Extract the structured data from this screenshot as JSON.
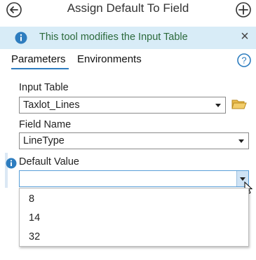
{
  "header": {
    "title": "Assign Default To Field",
    "back_icon": "back-arrow-icon",
    "add_icon": "add-icon"
  },
  "info_bar": {
    "message": "This tool modifies the Input Table",
    "icon": "info-icon",
    "close_glyph": "×"
  },
  "tabs": [
    {
      "label": "Parameters",
      "active": true
    },
    {
      "label": "Environments",
      "active": false
    }
  ],
  "help_glyph": "?",
  "params": {
    "input_table": {
      "label": "Input Table",
      "value": "Taxlot_Lines"
    },
    "field_name": {
      "label": "Field Name",
      "value": "LineType"
    },
    "default_value": {
      "label": "Default Value",
      "value": "",
      "options": [
        "8",
        "14",
        "32"
      ]
    }
  },
  "colors": {
    "accent": "#2e7dbf",
    "info_bg": "#d8ecf7",
    "info_text": "#2c6a3c"
  }
}
